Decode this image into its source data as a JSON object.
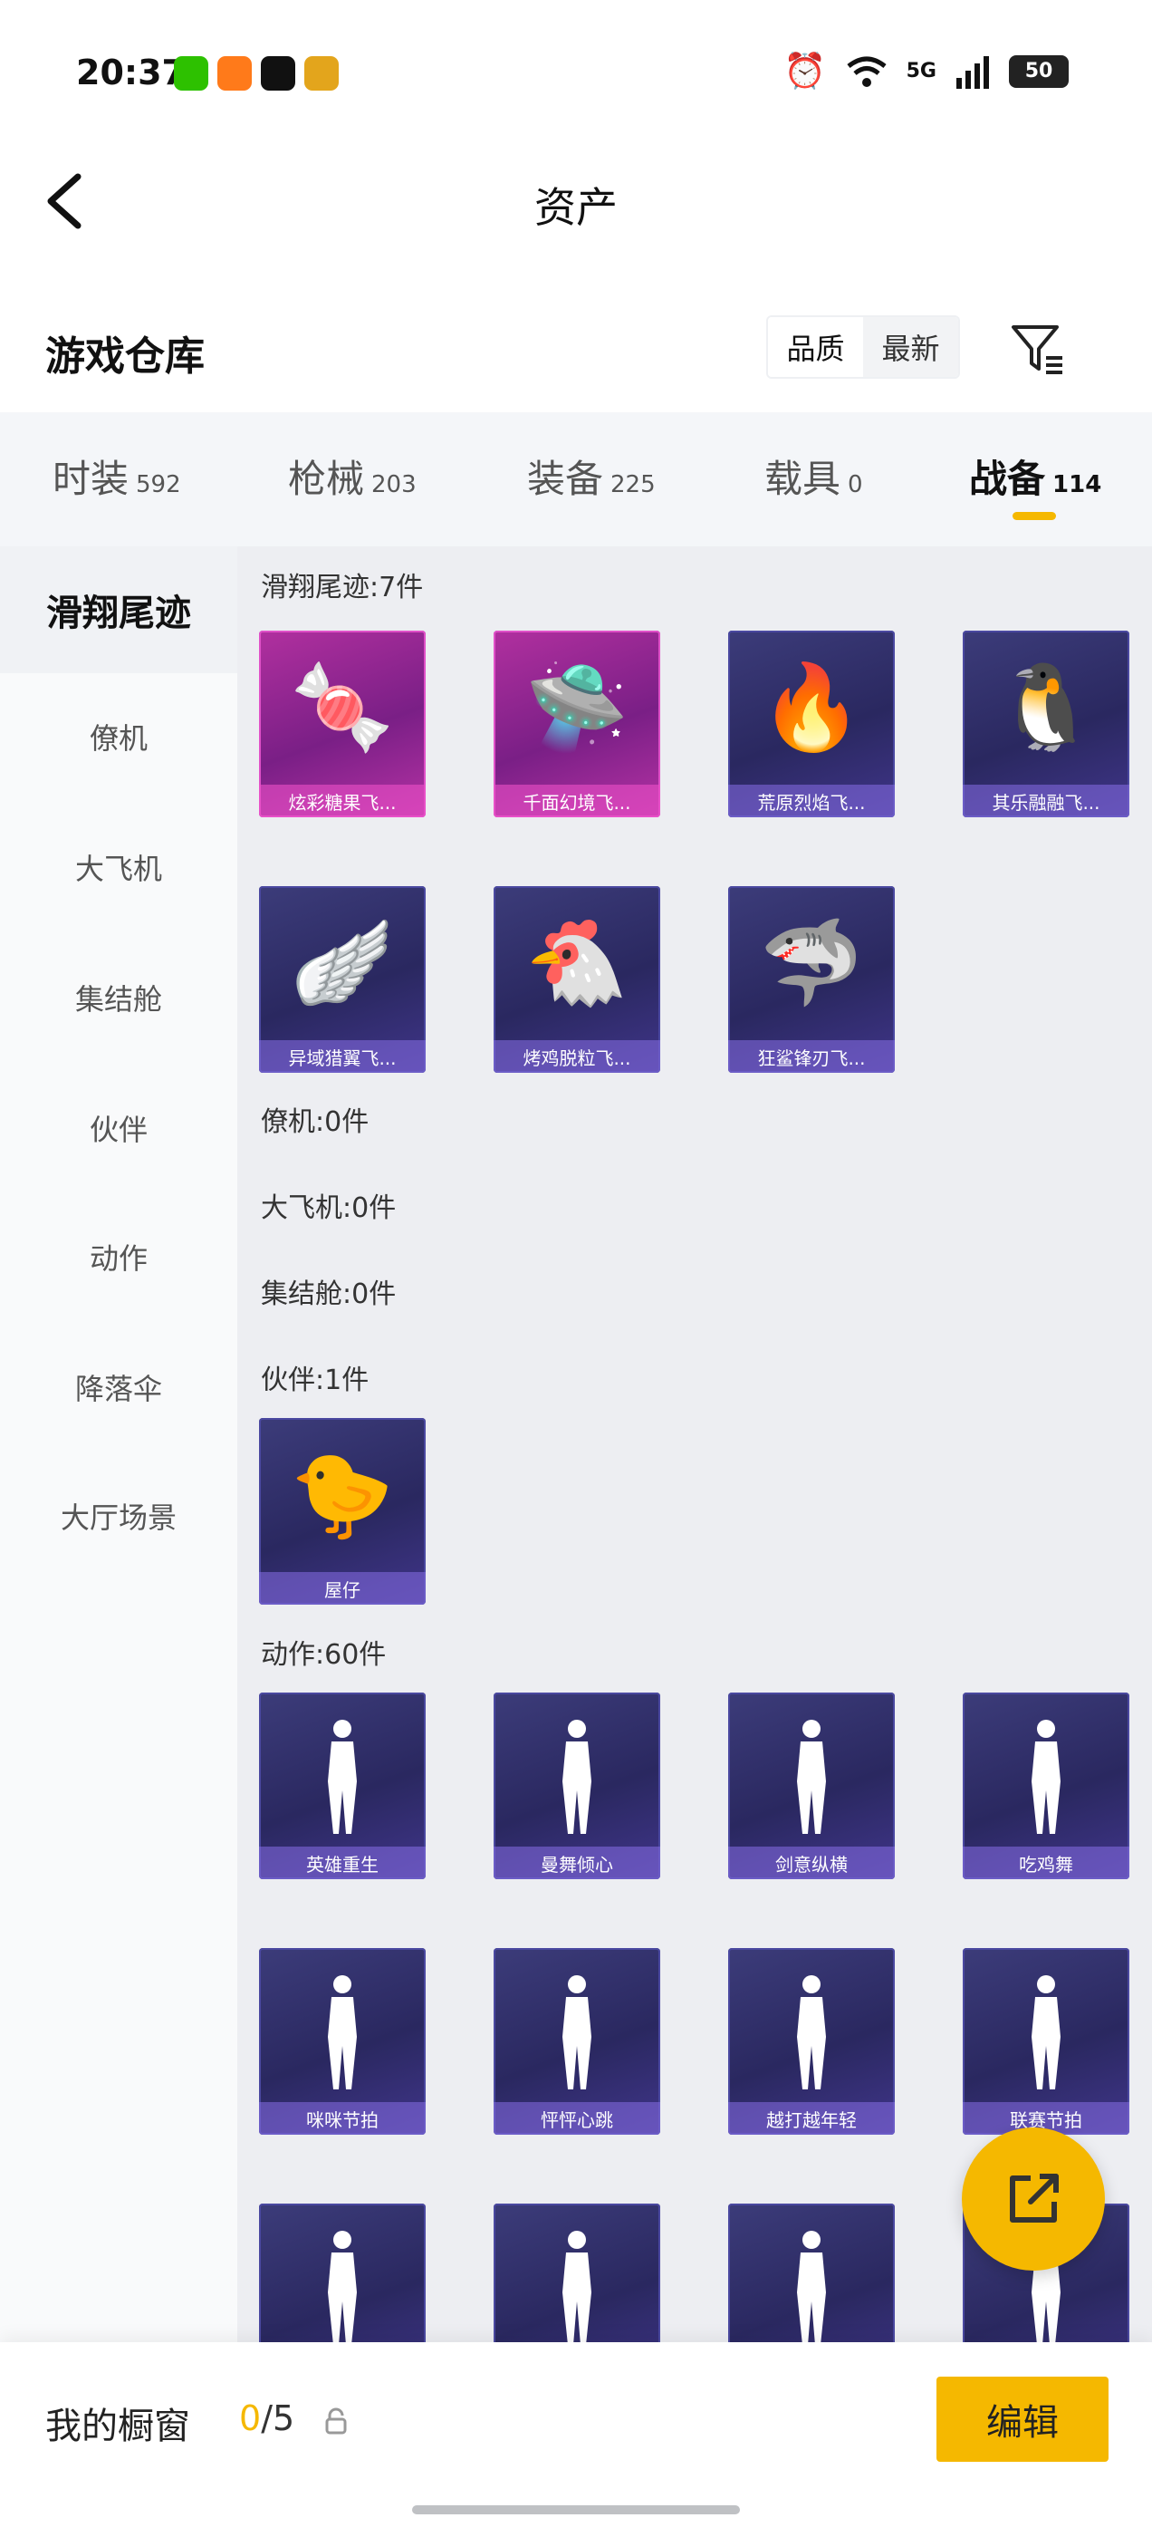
{
  "status_bar": {
    "time": "20:37",
    "network": "5G",
    "battery": "50"
  },
  "nav": {
    "title": "资产"
  },
  "header": {
    "title": "游戏仓库",
    "sort_options": [
      "品质",
      "最新"
    ]
  },
  "categories": [
    {
      "label": "时装",
      "count": "592"
    },
    {
      "label": "枪械",
      "count": "203"
    },
    {
      "label": "装备",
      "count": "225"
    },
    {
      "label": "载具",
      "count": "0"
    },
    {
      "label": "战备",
      "count": "114"
    }
  ],
  "sidebar": {
    "items": [
      "滑翔尾迹",
      "僚机",
      "大飞机",
      "集结舱",
      "伙伴",
      "动作",
      "降落伞",
      "大厅场景"
    ]
  },
  "groups": {
    "trail_title": "滑翔尾迹:7件",
    "wingman_title": "僚机:0件",
    "plane_title": "大飞机:0件",
    "pod_title": "集结舱:0件",
    "partner_title": "伙伴:1件",
    "emote_title": "动作:60件"
  },
  "trail_items": [
    "炫彩糖果飞...",
    "千面幻境飞...",
    "荒原烈焰飞...",
    "其乐融融飞...",
    "异域猎翼飞...",
    "烤鸡脱粒飞...",
    "狂鲨锋刃飞..."
  ],
  "partner_items": [
    "屋仔"
  ],
  "emote_items": [
    "英雄重生",
    "曼舞倾心",
    "剑意纵横",
    "吃鸡舞",
    "咪咪节拍",
    "怦怦心跳",
    "越打越年轻",
    "联赛节拍",
    "",
    "",
    "",
    ""
  ],
  "bottom": {
    "showcase_label": "我的橱窗",
    "showcase_current": "0",
    "showcase_total": "/5",
    "edit_label": "编辑"
  },
  "colors": {
    "accent": "#f5b800",
    "card_epic": "#2a2860",
    "card_legend": "#b1309f"
  }
}
